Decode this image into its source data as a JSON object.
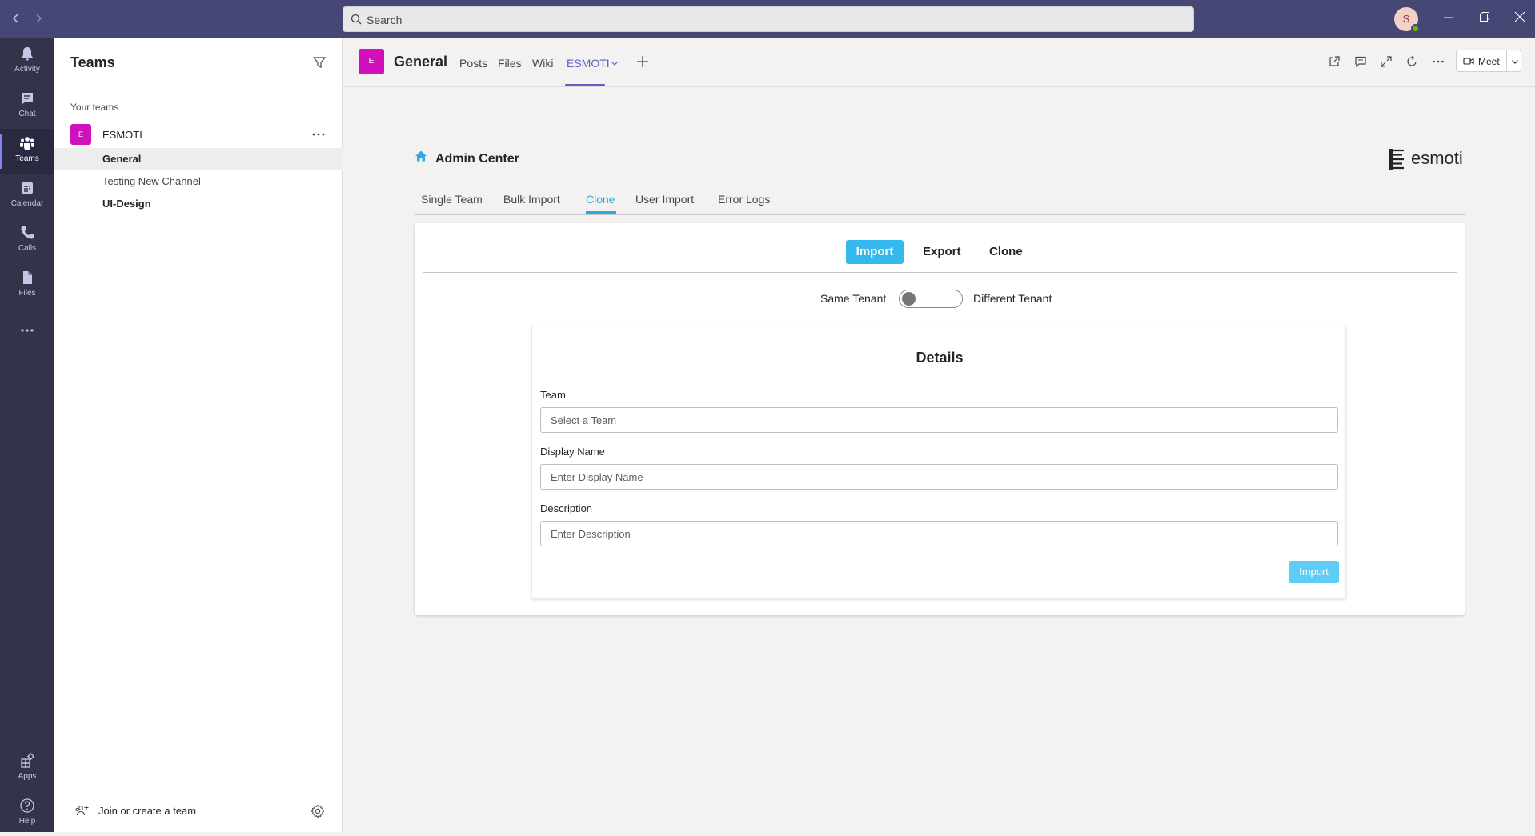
{
  "search": {
    "placeholder": "Search"
  },
  "user": {
    "initial": "S"
  },
  "rail": {
    "items": [
      {
        "label": "Activity"
      },
      {
        "label": "Chat"
      },
      {
        "label": "Teams"
      },
      {
        "label": "Calendar"
      },
      {
        "label": "Calls"
      },
      {
        "label": "Files"
      },
      {
        "label": ""
      },
      {
        "label": "Apps"
      },
      {
        "label": "Help"
      }
    ]
  },
  "teams_panel": {
    "title": "Teams",
    "section_label": "Your teams",
    "team": {
      "name": "ESMOTI",
      "initial": "E"
    },
    "channels": [
      "General",
      "Testing New Channel",
      "UI-Design"
    ],
    "join_label": "Join or create a team"
  },
  "channel_header": {
    "initial": "E",
    "title": "General",
    "tabs": [
      "Posts",
      "Files",
      "Wiki",
      "ESMOTI"
    ],
    "active_tab": "ESMOTI",
    "meet_label": "Meet"
  },
  "admin_center": {
    "title": "Admin Center",
    "logo_text": "esmoti",
    "tabs": [
      "Single Team",
      "Bulk Import",
      "Clone",
      "User Import",
      "Error Logs"
    ],
    "active_tab": "Clone",
    "segments": [
      "Import",
      "Export",
      "Clone"
    ],
    "active_segment": "Import",
    "tenant_left": "Same Tenant",
    "tenant_right": "Different Tenant",
    "tenant_toggle_on": false,
    "details": {
      "title": "Details",
      "team_label": "Team",
      "team_placeholder": "Select a Team",
      "display_name_label": "Display Name",
      "display_name_placeholder": "Enter Display Name",
      "description_label": "Description",
      "description_placeholder": "Enter Description",
      "submit_label": "Import"
    }
  },
  "colors": {
    "titlebar": "#464775",
    "rail": "#33344a",
    "brand_tab": "#5b5fc7",
    "accent_blue": "#35b8ee",
    "team_avatar": "#d10fbb"
  }
}
